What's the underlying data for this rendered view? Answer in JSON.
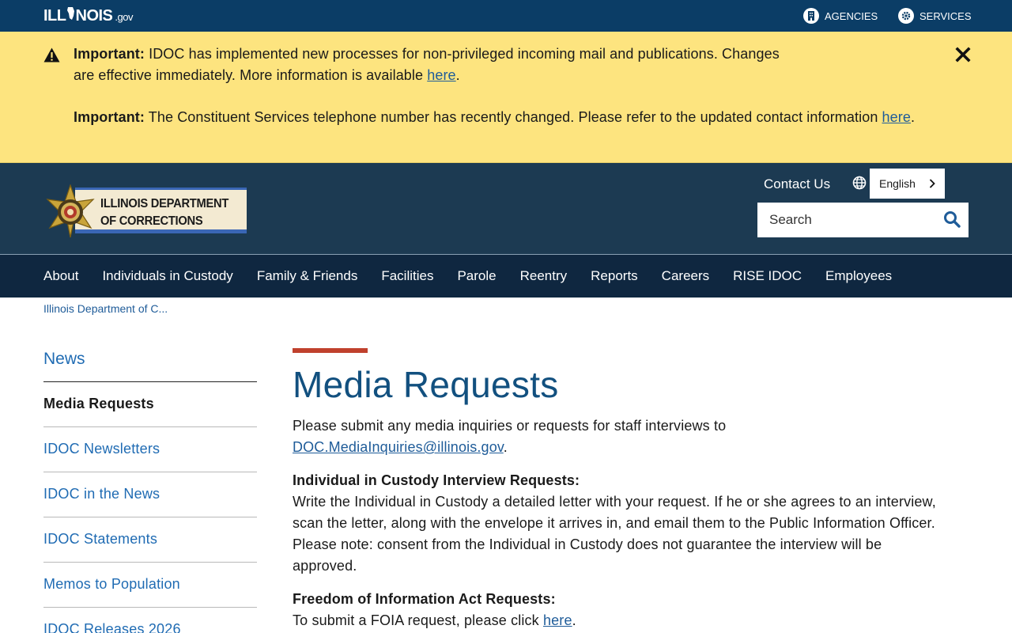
{
  "topbar": {
    "logo_text": "ILL",
    "logo_text_end": "NOIS",
    "logo_suffix": ".gov",
    "agencies_label": "AGENCIES",
    "services_label": "SERVICES",
    "agencies_icon": "building-icon",
    "services_icon": "gear-icon",
    "background_color": "#0b3d66"
  },
  "alert": {
    "background_color": "#fde47f",
    "icon": "warning-icon",
    "close_icon": "close-icon",
    "messages": [
      {
        "label": "Important:",
        "text_before": " IDOC has implemented new processes for non-privileged incoming mail and publications. Changes are effective immediately. More information is available ",
        "link_text": "here",
        "text_after": "."
      },
      {
        "label": "Important:",
        "text_before": " The Constituent Services telephone number has recently changed. Please refer to the updated contact information ",
        "link_text": "here",
        "text_after": "."
      }
    ]
  },
  "header": {
    "brand_line1": "ILLINOIS DEPARTMENT",
    "brand_line2": "OF CORRECTIONS",
    "contact_label": "Contact Us",
    "language_selected": "English",
    "search_placeholder": "Search",
    "background_color": "#1c3a52"
  },
  "nav": {
    "items": [
      "About",
      "Individuals in Custody",
      "Family & Friends",
      "Facilities",
      "Parole",
      "Reentry",
      "Reports",
      "Careers",
      "RISE IDOC",
      "Employees"
    ]
  },
  "breadcrumb": {
    "text": "Illinois Department of C..."
  },
  "sidebar": {
    "heading": "News",
    "items": [
      "Media Requests",
      "IDOC Newsletters",
      "IDOC in the News",
      "IDOC Statements",
      "Memos to Population",
      "IDOC Releases 2026"
    ],
    "active_index": 0
  },
  "main": {
    "title": "Media Requests",
    "accent_color": "#c0412d",
    "intro_text": "Please submit any media inquiries or requests for staff interviews to ",
    "intro_email": "DOC.MediaInquiries@illinois.gov",
    "intro_end": ".",
    "interview_title": "Individual in Custody Interview Requests:",
    "interview_text": "Write the Individual in Custody a detailed letter with your request. If he or she agrees to an interview, scan the letter, along with the envelope it arrives in, and email them to the Public Information Officer. Please note: consent from the Individual in Custody does not guarantee the interview will be approved.",
    "foia_title": "Freedom of Information Act Requests:",
    "foia_text": "To submit a FOIA request, please click ",
    "foia_link": "here",
    "foia_end": "."
  }
}
